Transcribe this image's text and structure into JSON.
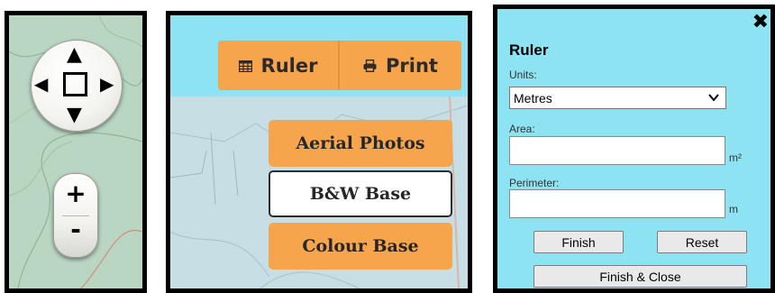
{
  "navigation": {
    "pan_up": "▲",
    "pan_down": "▼",
    "pan_left": "◀",
    "pan_right": "▶",
    "zoom_in": "+",
    "zoom_out": "-"
  },
  "toolbar": {
    "ruler_label": "Ruler",
    "print_label": "Print"
  },
  "base_layers": [
    {
      "label": "Aerial Photos",
      "active": false
    },
    {
      "label": "B&W Base",
      "active": true
    },
    {
      "label": "Colour Base",
      "active": false
    }
  ],
  "ruler_dialog": {
    "close": "✖",
    "title": "Ruler",
    "units_label": "Units:",
    "units_value": "Metres",
    "area_label": "Area:",
    "area_value": "",
    "area_unit": "m²",
    "perimeter_label": "Perimeter:",
    "perimeter_value": "",
    "perimeter_unit": "m",
    "finish_label": "Finish",
    "reset_label": "Reset",
    "finish_close_label": "Finish & Close"
  },
  "colors": {
    "dialog_bg": "#8ee3f3",
    "button_orange": "#f7a54d",
    "map_green": "#b9d6c2"
  }
}
